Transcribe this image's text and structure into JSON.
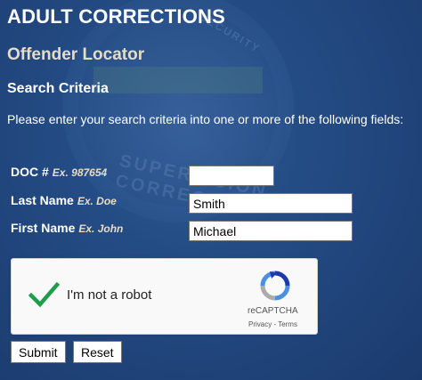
{
  "header": {
    "title": "ADULT CORRECTIONS",
    "subtitle": "Offender Locator",
    "section_title": "Search Criteria",
    "instructions": "Please enter your search criteria into one or more of the following fields:"
  },
  "form": {
    "doc": {
      "label": "DOC #",
      "example": "Ex. 987654",
      "value": ""
    },
    "last_name": {
      "label": "Last Name",
      "example": "Ex. Doe",
      "value": "Smith"
    },
    "first_name": {
      "label": "First Name",
      "example": "Ex. John",
      "value": "Michael"
    }
  },
  "captcha": {
    "label": "I'm not a robot",
    "brand": "reCAPTCHA",
    "links": "Privacy - Terms",
    "checked": true,
    "check_color": "#1e9e4a"
  },
  "buttons": {
    "submit": "Submit",
    "reset": "Reset"
  },
  "watermark": {
    "top_text": "SECURITY",
    "bottom_text": "SUPERVISION CORRECT"
  },
  "colors": {
    "background": "#244c84",
    "subtitle": "#e6dcc4"
  }
}
